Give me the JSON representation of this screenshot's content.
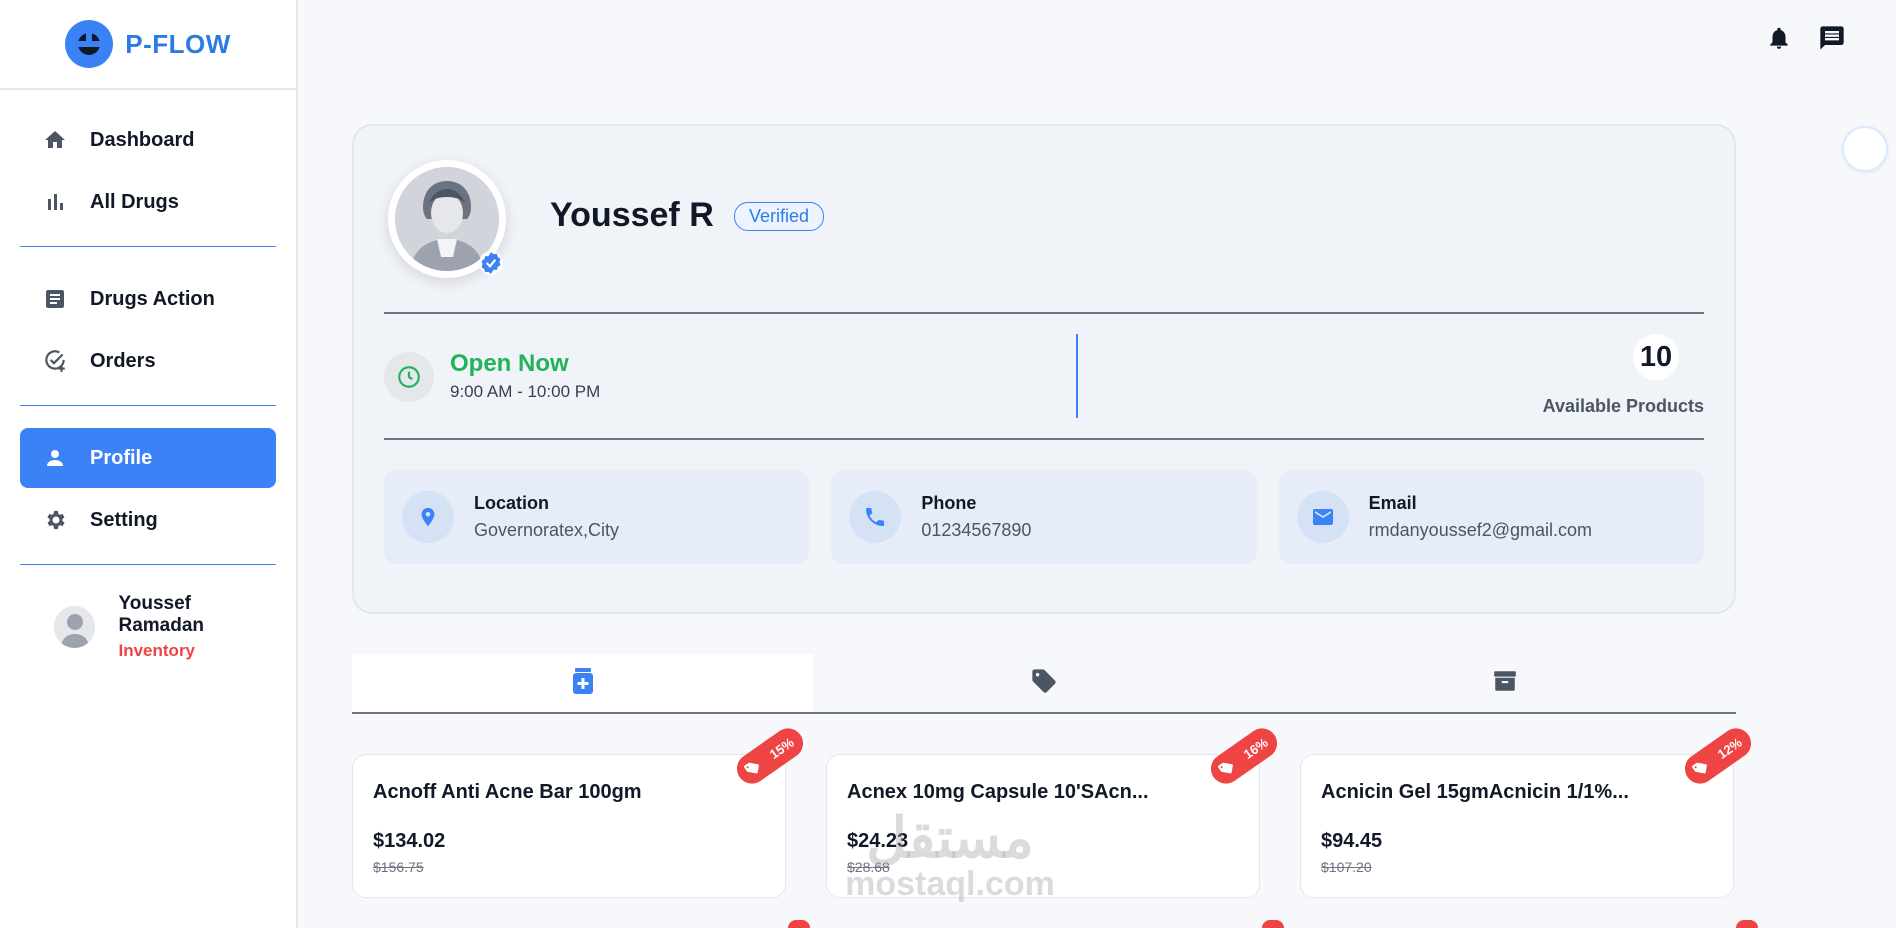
{
  "app": {
    "brand": "P-FLOW"
  },
  "sidebar": {
    "items": [
      {
        "label": "Dashboard",
        "icon": "home-icon"
      },
      {
        "label": "All Drugs",
        "icon": "bar-chart-icon"
      },
      {
        "label": "Drugs Action",
        "icon": "document-icon"
      },
      {
        "label": "Orders",
        "icon": "check-circle-add-icon"
      },
      {
        "label": "Profile",
        "icon": "person-icon",
        "active": true
      },
      {
        "label": "Setting",
        "icon": "gear-icon"
      }
    ],
    "user": {
      "name": "Youssef Ramadan",
      "role": "Inventory"
    }
  },
  "profile": {
    "name": "Youssef R",
    "badge": "Verified",
    "status": "Open Now",
    "hours": "9:00 AM - 10:00 PM",
    "products_count": "10",
    "products_label": "Available Products",
    "info": {
      "location": {
        "title": "Location",
        "value": "Governoratex,City"
      },
      "phone": {
        "title": "Phone",
        "value": "01234567890"
      },
      "email": {
        "title": "Email",
        "value": "rmdanyoussef2@gmail.com"
      }
    }
  },
  "tabs": [
    {
      "icon": "medicine-bottle-icon",
      "active": true
    },
    {
      "icon": "tag-icon"
    },
    {
      "icon": "archive-icon"
    }
  ],
  "products": [
    {
      "name": "Acnoff Anti Acne Bar 100gm",
      "price": "$134.02",
      "old_price": "$156.75",
      "discount": "15%"
    },
    {
      "name": "Acnex 10mg Capsule 10'SAcn...",
      "price": "$24.23",
      "old_price": "$28.68",
      "discount": "16%"
    },
    {
      "name": "Acnicin Gel 15gmAcnicin 1/1%...",
      "price": "$94.45",
      "old_price": "$107.20",
      "discount": "12%"
    }
  ],
  "watermark": {
    "line1": "مستقل",
    "line2": "mostaql.com"
  },
  "colors": {
    "primary": "#3b82f6",
    "success": "#22b35a",
    "danger": "#ef4444"
  }
}
